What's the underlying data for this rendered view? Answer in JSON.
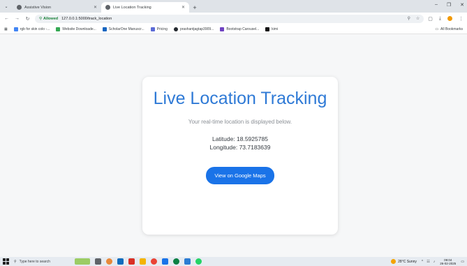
{
  "browser": {
    "tabs": [
      {
        "label": "Assistive Vision",
        "active": false
      },
      {
        "label": "Live Location Tracking",
        "active": true
      }
    ],
    "address": {
      "permission": "Allowed",
      "url": "127.0.0.1:5000/track_location"
    },
    "bookmarks": [
      {
        "label": "rgb for skin colo -..."
      },
      {
        "label": "Website Downloade..."
      },
      {
        "label": "ScholarOne Manuscr..."
      },
      {
        "label": "Pricing"
      },
      {
        "label": "prashantjagtap3909..."
      },
      {
        "label": "Bootstrap Carousel..."
      },
      {
        "label": "kimi"
      }
    ],
    "all_bookmarks": "All Bookmarks"
  },
  "page": {
    "title": "Live Location Tracking",
    "subtitle": "Your real-time location is displayed below.",
    "latitude": "Latitude: 18.5925785",
    "longitude": "Longitude: 73.7183639",
    "button": "View on Google Maps"
  },
  "taskbar": {
    "search_placeholder": "Type here to search",
    "weather": "28°C  Sunny",
    "time": "09:04",
    "date": "26-02-2025"
  },
  "colors": {
    "accent": "#2f7ad6",
    "button": "#1a73e8"
  }
}
